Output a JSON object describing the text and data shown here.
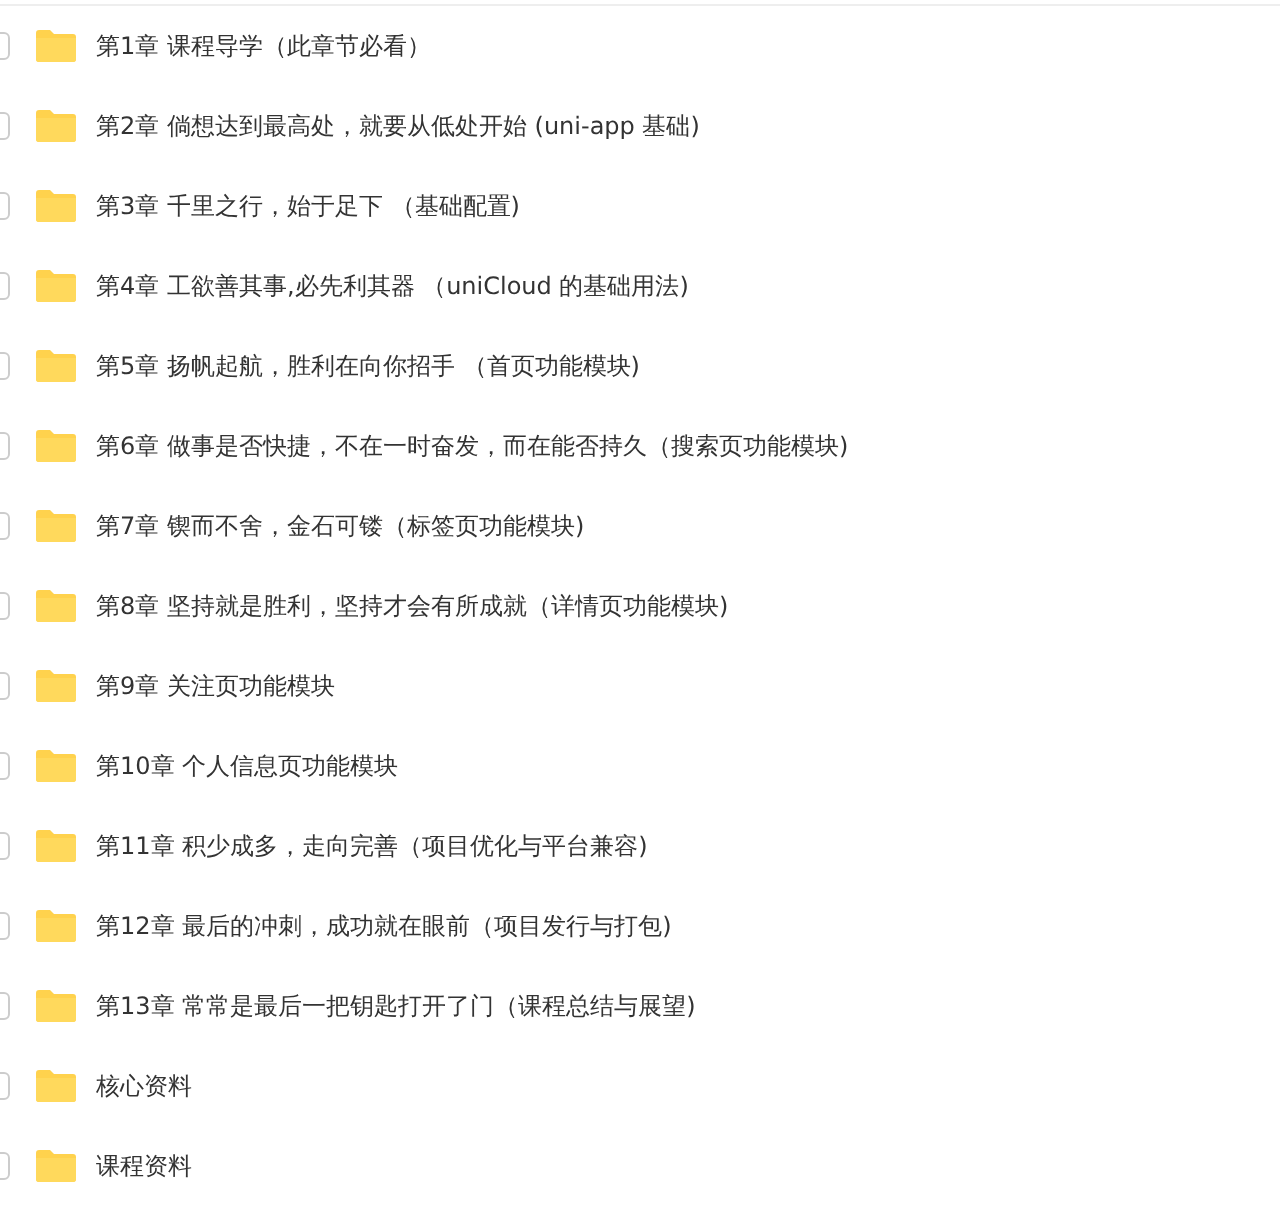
{
  "files": [
    {
      "name": "第1章 课程导学（此章节必看）",
      "checked": false
    },
    {
      "name": "第2章 倘想达到最高处，就要从低处开始 (uni-app 基础)",
      "checked": false
    },
    {
      "name": "第3章 千里之行，始于足下 （基础配置)",
      "checked": false
    },
    {
      "name": "第4章 工欲善其事,必先利其器 （uniCloud 的基础用法)",
      "checked": false
    },
    {
      "name": "第5章 扬帆起航，胜利在向你招手 （首页功能模块)",
      "checked": false
    },
    {
      "name": "第6章 做事是否快捷，不在一时奋发，而在能否持久（搜索页功能模块)",
      "checked": false
    },
    {
      "name": "第7章 锲而不舍，金石可镂（标签页功能模块)",
      "checked": false
    },
    {
      "name": "第8章 坚持就是胜利，坚持才会有所成就（详情页功能模块)",
      "checked": false
    },
    {
      "name": "第9章 关注页功能模块",
      "checked": false
    },
    {
      "name": "第10章 个人信息页功能模块",
      "checked": false
    },
    {
      "name": "第11章 积少成多，走向完善（项目优化与平台兼容)",
      "checked": false
    },
    {
      "name": "第12章 最后的冲刺，成功就在眼前（项目发行与打包)",
      "checked": false
    },
    {
      "name": "第13章 常常是最后一把钥匙打开了门（课程总结与展望)",
      "checked": false
    },
    {
      "name": "核心资料",
      "checked": false
    },
    {
      "name": "课程资料",
      "checked": false
    }
  ]
}
